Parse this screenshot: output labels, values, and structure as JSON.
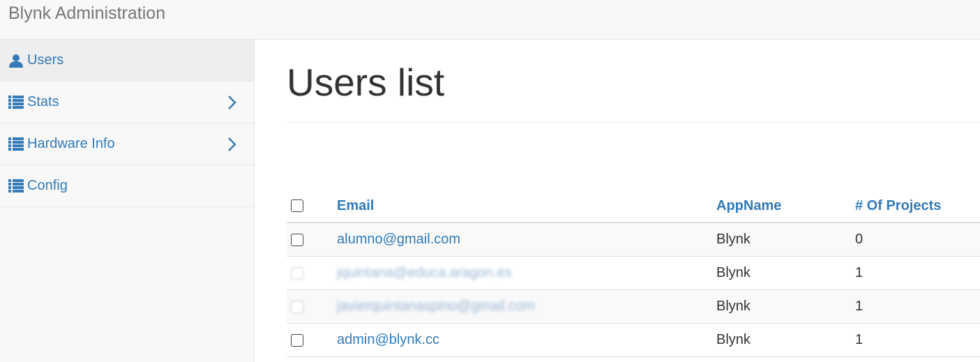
{
  "app": {
    "title": "Blynk Administration"
  },
  "sidebar": {
    "items": [
      {
        "label": "Users",
        "icon": "user-icon",
        "active": true,
        "has_chevron": false
      },
      {
        "label": "Stats",
        "icon": "list-icon",
        "active": false,
        "has_chevron": true
      },
      {
        "label": "Hardware Info",
        "icon": "list-icon",
        "active": false,
        "has_chevron": true
      },
      {
        "label": "Config",
        "icon": "list-icon",
        "active": false,
        "has_chevron": false
      }
    ]
  },
  "main": {
    "title": "Users list",
    "table": {
      "headers": {
        "email": "Email",
        "app": "AppName",
        "projects": "# Of Projects"
      },
      "rows": [
        {
          "email": "alumno@gmail.com",
          "app": "Blynk",
          "projects": "0",
          "blurred": false
        },
        {
          "email": "jquintana@educa.aragon.es",
          "app": "Blynk",
          "projects": "1",
          "blurred": true
        },
        {
          "email": "javierquintanaspino@gmail.com",
          "app": "Blynk",
          "projects": "1",
          "blurred": true
        },
        {
          "email": "admin@blynk.cc",
          "app": "Blynk",
          "projects": "1",
          "blurred": false
        }
      ]
    }
  },
  "colors": {
    "link": "#337ab7",
    "navbar_bg": "#f8f8f8",
    "active_bg": "#eeeeee"
  }
}
